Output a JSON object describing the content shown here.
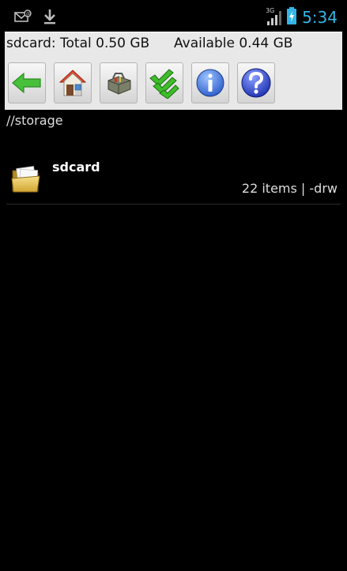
{
  "status_bar": {
    "time": "5:34",
    "network_label": "3G",
    "icons": [
      "mail-notification-icon",
      "download-icon",
      "signal-icon",
      "battery-charging-icon"
    ]
  },
  "storage": {
    "total_text": "sdcard: Total 0.50 GB",
    "available_text": "Available 0.44 GB"
  },
  "toolbar": {
    "buttons": [
      "back-arrow-icon",
      "home-icon",
      "toolbox-icon",
      "multi-select-check-icon",
      "info-icon",
      "help-icon"
    ]
  },
  "path": "//storage",
  "files": [
    {
      "name": "sdcard",
      "meta": "22 items | -drw",
      "icon": "folder-icon"
    }
  ],
  "colors": {
    "time": "#33b5e5",
    "background": "#000000",
    "panel": "#e8e8e8",
    "back_arrow": "#48c03c",
    "check": "#3ebd2a",
    "info": "#3a6fd8"
  }
}
